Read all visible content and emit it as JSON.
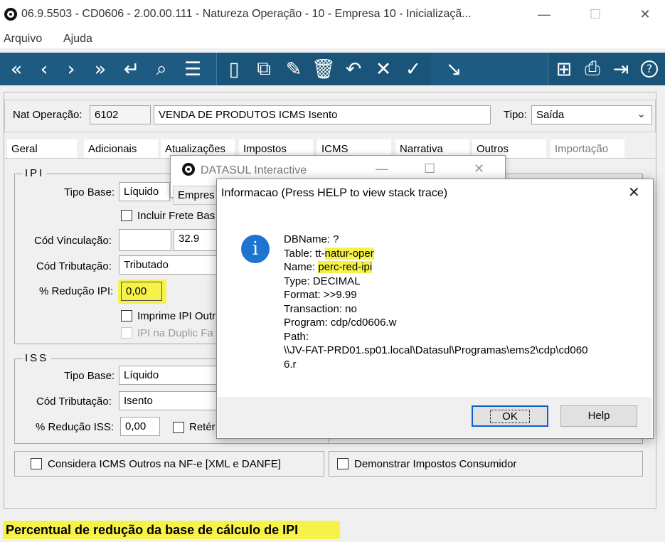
{
  "window": {
    "title": "06.9.5503 - CD0606 - 2.00.00.111 - Natureza Operação - 10 - Empresa 10 - Inicializaçã...",
    "minimize": "—",
    "maximize": "☐",
    "close": "✕"
  },
  "menu": {
    "items": [
      "Arquivo",
      "Ajuda"
    ]
  },
  "toolbar": {
    "accent": "#1d5b82",
    "buttons": [
      {
        "name": "first-icon",
        "glyph": "«"
      },
      {
        "name": "prev-icon",
        "glyph": "‹"
      },
      {
        "name": "next-icon",
        "glyph": "›"
      },
      {
        "name": "last-icon",
        "glyph": "»"
      },
      {
        "name": "goto-icon",
        "glyph": "↵"
      },
      {
        "name": "search-icon",
        "glyph": "⌕"
      },
      {
        "name": "filter-icon",
        "glyph": "☰"
      },
      {
        "name": "new-icon",
        "glyph": "▯"
      },
      {
        "name": "copy-icon",
        "glyph": "⧉"
      },
      {
        "name": "edit-icon",
        "glyph": "✎"
      },
      {
        "name": "delete-icon",
        "glyph": "🗑"
      },
      {
        "name": "undo-icon",
        "glyph": "↶"
      },
      {
        "name": "cancel-icon",
        "glyph": "✕"
      },
      {
        "name": "confirm-icon",
        "glyph": "✓"
      },
      {
        "name": "trend-icon",
        "glyph": "↘"
      },
      {
        "name": "tree-icon",
        "glyph": "⊞"
      },
      {
        "name": "print-icon",
        "glyph": "⎙"
      },
      {
        "name": "exit-icon",
        "glyph": "⇥"
      },
      {
        "name": "help-icon",
        "glyph": "?"
      }
    ]
  },
  "header": {
    "nat_label": "Nat Operação:",
    "nat_code": "6102",
    "nat_desc": "VENDA DE PRODUTOS ICMS Isento",
    "tipo_label": "Tipo:",
    "tipo_value": "Saída"
  },
  "tabs": [
    "Geral",
    "Adicionais",
    "Atualizações",
    "Impostos",
    "ICMS",
    "Narrativa",
    "Outros",
    "Importação"
  ],
  "ipi": {
    "title": "IPI",
    "tipo_base_label": "Tipo Base:",
    "tipo_base_value": "Líquido",
    "incluir_frete": "Incluir Frete Bas",
    "cod_vinc_label": "Cód Vinculação:",
    "cod_vinc_value": "",
    "cod_vinc_num": "32.9",
    "cod_trib_label": "Cód Tributação:",
    "cod_trib_value": "Tributado",
    "reducao_label": "% Redução IPI:",
    "reducao_value": "0,00",
    "imprime": "Imprime IPI Outr",
    "duplic": "IPI na Duplic Fa"
  },
  "iss": {
    "title": "ISS",
    "tipo_base_label": "Tipo Base:",
    "tipo_base_value": "Líquido",
    "cod_trib_label": "Cód Tributação:",
    "cod_trib_value": "Isento",
    "reducao_label": "% Redução ISS:",
    "reducao_value": "0,00",
    "retem": "Retér"
  },
  "bottom": {
    "considera": "Considera ICMS Outros na NF-e [XML e DANFE]",
    "demonstrar": "Demonstrar Impostos Consumidor"
  },
  "back_dialog": {
    "title": "DATASUL Interactive",
    "partial_label": "Empres"
  },
  "dialog": {
    "title": "Informacao (Press HELP to view stack trace)",
    "close": "✕",
    "icon": "i",
    "lines": {
      "dbname": "DBName: ?",
      "table_prefix": "Table: tt-",
      "table_hl": "natur-oper",
      "name_prefix": "Name: ",
      "name_hl": "perc-red-ipi",
      "type": "Type: DECIMAL",
      "format": "Format: >>9.99",
      "transaction": "Transaction: no",
      "program": "Program: cdp/cd0606.w",
      "path_label": "Path:",
      "path1": "\\\\JV-FAT-PRD01.sp01.local\\Datasul\\Programas\\ems2\\cdp\\cd060",
      "path2": "6.r"
    },
    "ok": "OK",
    "help": "Help"
  },
  "status": {
    "text": "Percentual de redução da base de cálculo de IPI",
    "highlight": "#f6f24a"
  }
}
